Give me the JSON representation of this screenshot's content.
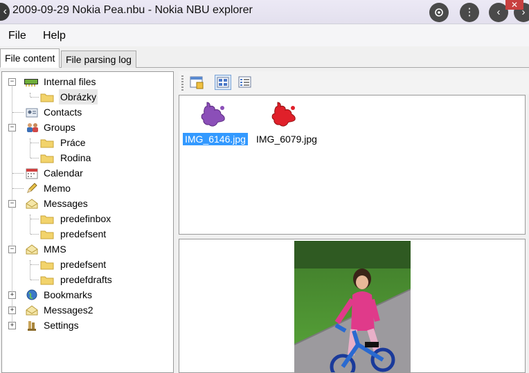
{
  "window": {
    "title": "2009-09-29 Nokia Pea.nbu - Nokia NBU explorer"
  },
  "menu": {
    "file": "File",
    "help": "Help"
  },
  "tabs": [
    {
      "label": "File content"
    },
    {
      "label": "File parsing log"
    }
  ],
  "tree": {
    "items": [
      {
        "label": "Internal files",
        "icon": "memory-chip-icon",
        "expander": "−"
      },
      {
        "label": "Obrázky",
        "icon": "folder-icon"
      },
      {
        "label": "Contacts",
        "icon": "contacts-card-icon"
      },
      {
        "label": "Groups",
        "icon": "people-group-icon",
        "expander": "−"
      },
      {
        "label": "Práce",
        "icon": "folder-icon"
      },
      {
        "label": "Rodina",
        "icon": "folder-icon"
      },
      {
        "label": "Calendar",
        "icon": "calendar-icon"
      },
      {
        "label": "Memo",
        "icon": "pencil-icon"
      },
      {
        "label": "Messages",
        "icon": "envelope-icon",
        "expander": "−"
      },
      {
        "label": "predefinbox",
        "icon": "folder-icon"
      },
      {
        "label": "predefsent",
        "icon": "folder-icon"
      },
      {
        "label": "MMS",
        "icon": "envelope-icon",
        "expander": "−"
      },
      {
        "label": "predefsent",
        "icon": "folder-icon"
      },
      {
        "label": "predefdrafts",
        "icon": "folder-icon"
      },
      {
        "label": "Bookmarks",
        "icon": "globe-icon",
        "expander": "+"
      },
      {
        "label": "Messages2",
        "icon": "envelope-icon",
        "expander": "+"
      },
      {
        "label": "Settings",
        "icon": "wrench-icon",
        "expander": "+"
      }
    ]
  },
  "files": [
    {
      "name": "IMG_6146.jpg",
      "icon_color": "#8b4fb8",
      "selected": true
    },
    {
      "name": "IMG_6079.jpg",
      "icon_color": "#e0202a",
      "selected": false
    }
  ],
  "colors": {
    "selection": "#3399ff",
    "window_bg": "#f0f0f0"
  }
}
